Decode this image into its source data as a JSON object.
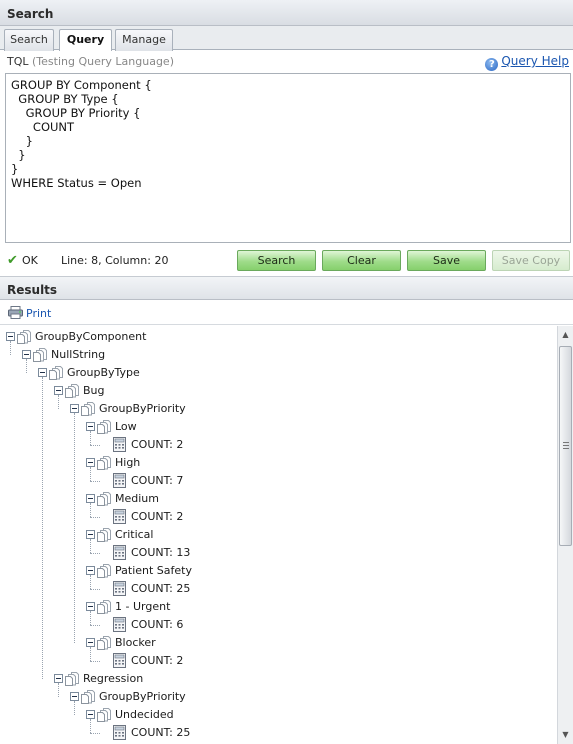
{
  "search_panel": {
    "title": "Search"
  },
  "tabs": [
    {
      "label": "Search"
    },
    {
      "label": "Query",
      "active": true
    },
    {
      "label": "Manage"
    }
  ],
  "tql": {
    "label": "TQL",
    "label_sub": "(Testing Query Language)",
    "help_link": "Query Help",
    "help_icon": "?"
  },
  "query_text": "GROUP BY Component {\n  GROUP BY Type {\n    GROUP BY Priority {\n      COUNT\n    }\n  }\n}\nWHERE Status = Open",
  "status": {
    "check": "✔",
    "ok": "OK",
    "position": "Line: 8, Column: 20"
  },
  "buttons": {
    "search": "Search",
    "clear": "Clear",
    "save": "Save",
    "save_copy": "Save Copy"
  },
  "results_panel": {
    "title": "Results"
  },
  "print_label": "Print",
  "tree": [
    {
      "label": "GroupByComponent",
      "level": 0,
      "kind": "group"
    },
    {
      "label": "NullString",
      "level": 1,
      "kind": "group"
    },
    {
      "label": "GroupByType",
      "level": 2,
      "kind": "group"
    },
    {
      "label": "Bug",
      "level": 3,
      "kind": "group"
    },
    {
      "label": "GroupByPriority",
      "level": 4,
      "kind": "group"
    },
    {
      "label": "Low",
      "level": 5,
      "kind": "group"
    },
    {
      "label": "COUNT: 2",
      "level": 6,
      "kind": "count"
    },
    {
      "label": "High",
      "level": 5,
      "kind": "group"
    },
    {
      "label": "COUNT: 7",
      "level": 6,
      "kind": "count"
    },
    {
      "label": "Medium",
      "level": 5,
      "kind": "group"
    },
    {
      "label": "COUNT: 2",
      "level": 6,
      "kind": "count"
    },
    {
      "label": "Critical",
      "level": 5,
      "kind": "group"
    },
    {
      "label": "COUNT: 13",
      "level": 6,
      "kind": "count"
    },
    {
      "label": "Patient Safety",
      "level": 5,
      "kind": "group"
    },
    {
      "label": "COUNT: 25",
      "level": 6,
      "kind": "count"
    },
    {
      "label": "1 - Urgent",
      "level": 5,
      "kind": "group"
    },
    {
      "label": "COUNT: 6",
      "level": 6,
      "kind": "count"
    },
    {
      "label": "Blocker",
      "level": 5,
      "kind": "group"
    },
    {
      "label": "COUNT: 2",
      "level": 6,
      "kind": "count"
    },
    {
      "label": "Regression",
      "level": 3,
      "kind": "group"
    },
    {
      "label": "GroupByPriority",
      "level": 4,
      "kind": "group"
    },
    {
      "label": "Undecided",
      "level": 5,
      "kind": "group"
    },
    {
      "label": "COUNT: 25",
      "level": 6,
      "kind": "count"
    }
  ],
  "colors": {
    "button_green": "#9fdc8a",
    "link_blue": "#1a56b0",
    "ok_green": "#3f9a29"
  }
}
